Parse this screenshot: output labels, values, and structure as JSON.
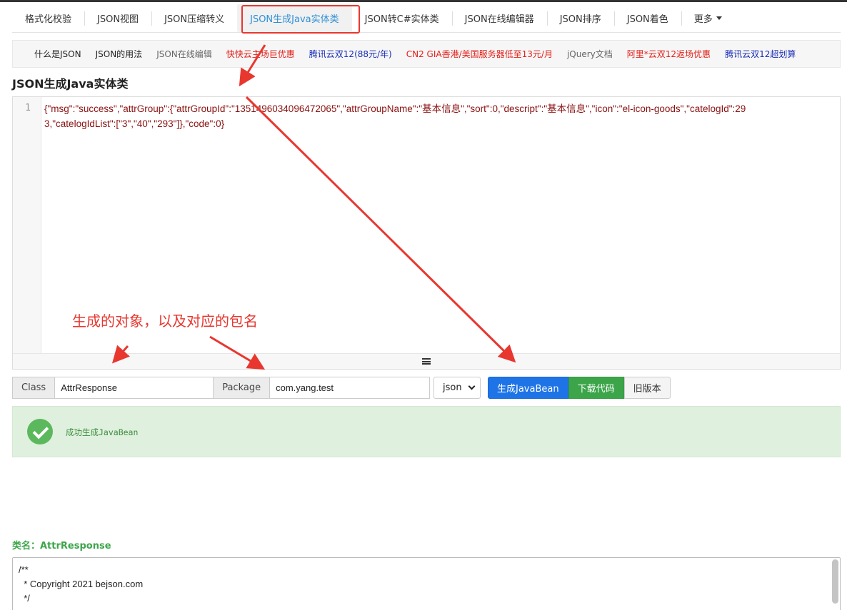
{
  "nav": {
    "items": [
      "格式化校验",
      "JSON视图",
      "JSON压缩转义",
      "JSON生成Java实体类",
      "JSON转C#实体类",
      "JSON在线编辑器",
      "JSON排序",
      "JSON着色",
      "更多"
    ],
    "active_index": 3
  },
  "sublinks": [
    {
      "label": "什么是JSON",
      "color": "#222222"
    },
    {
      "label": "JSON的用法",
      "color": "#222222"
    },
    {
      "label": "JSON在线编辑",
      "color": "#666666"
    },
    {
      "label": "快快云主场巨优惠",
      "color": "#e3201a"
    },
    {
      "label": "腾讯云双12(88元/年)",
      "color": "#1a2db5"
    },
    {
      "label": "CN2 GIA香港/美国服务器低至13元/月",
      "color": "#e3201a"
    },
    {
      "label": "jQuery文档",
      "color": "#666666"
    },
    {
      "label": "阿里*云双12返场优惠",
      "color": "#e3201a"
    },
    {
      "label": "腾讯云双12超划算",
      "color": "#1a2db5"
    }
  ],
  "page_title": "JSON生成Java实体类",
  "editor": {
    "line_number": "1",
    "content": "{\"msg\":\"success\",\"attrGroup\":{\"attrGroupId\":\"1351496034096472065\",\"attrGroupName\":\"基本信息\",\"sort\":0,\"descript\":\"基本信息\",\"icon\":\"el-icon-goods\",\"catelogId\":293,\"catelogIdList\":[\"3\",\"40\",\"293\"]},\"code\":0}"
  },
  "annotation_text": "生成的对象，以及对应的包名",
  "form": {
    "class_label": "Class",
    "class_value": "AttrResponse",
    "package_label": "Package",
    "package_value": "com.yang.test",
    "format_selected": "json"
  },
  "buttons": {
    "generate": "生成JavaBean",
    "download": "下载代码",
    "old_version": "旧版本"
  },
  "alert": {
    "message": "成功生成JavaBean"
  },
  "result": {
    "class_name_label": "类名：AttrResponse",
    "lines": [
      "/**",
      "  * Copyright 2021 bejson.com",
      "  */"
    ]
  },
  "colors": {
    "active_nav": "#2d8fd5",
    "annotation": "#e8372f",
    "primary_button": "#1e74e6",
    "success_button": "#3ca54a",
    "alert_bg": "#dff0de"
  }
}
